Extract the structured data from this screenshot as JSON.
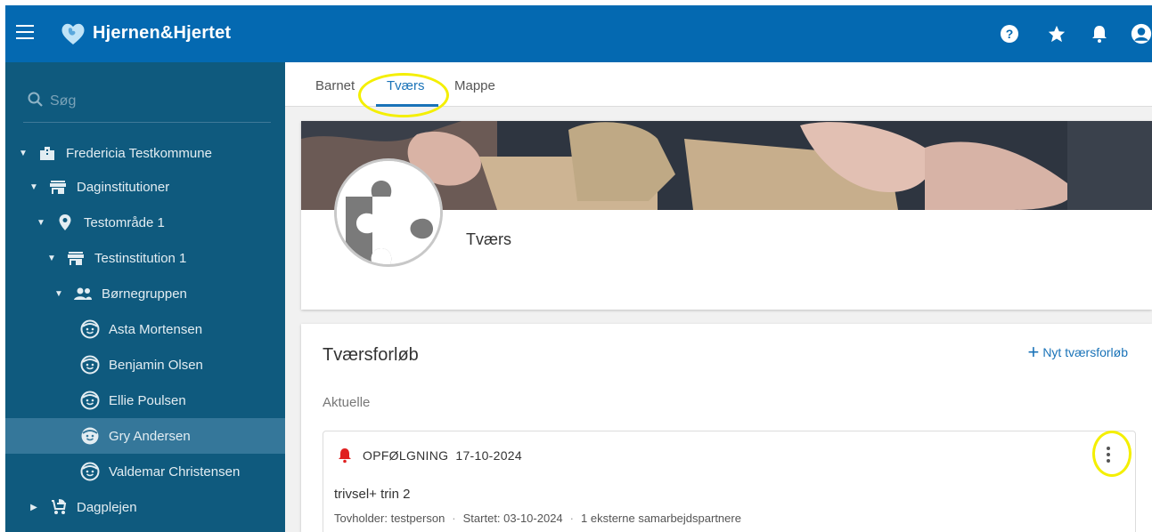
{
  "app": {
    "title": "Hjernen&Hjertet"
  },
  "topbar": {
    "icons": [
      "help-icon",
      "star-icon",
      "bell-icon",
      "account-icon"
    ]
  },
  "sidebar": {
    "search": {
      "placeholder": "Søg",
      "value": ""
    },
    "items": [
      {
        "label": "Fredericia Testkommune",
        "icon": "building-icon",
        "expanded": true
      },
      {
        "label": "Daginstitutioner",
        "icon": "store-icon",
        "expanded": true
      },
      {
        "label": "Testområde 1",
        "icon": "location-pin-icon",
        "expanded": true
      },
      {
        "label": "Testinstitution 1",
        "icon": "store-icon",
        "expanded": true
      },
      {
        "label": "Børnegruppen",
        "icon": "group-icon",
        "expanded": true
      },
      {
        "label": "Asta Mortensen",
        "icon": "child-face-icon"
      },
      {
        "label": "Benjamin Olsen",
        "icon": "child-face-icon"
      },
      {
        "label": "Ellie Poulsen",
        "icon": "child-face-icon"
      },
      {
        "label": "Gry Andersen",
        "icon": "child-face-icon",
        "selected": true
      },
      {
        "label": "Valdemar Christensen",
        "icon": "child-face-icon"
      },
      {
        "label": "Dagplejen",
        "icon": "stroller-icon",
        "expanded": false
      }
    ]
  },
  "tabs": [
    {
      "label": "Barnet"
    },
    {
      "label": "Tværs",
      "active": true
    },
    {
      "label": "Mappe"
    }
  ],
  "profile": {
    "name": "Tværs",
    "avatar_icon": "puzzle-icon"
  },
  "forlob": {
    "title": "Tværsforløb",
    "new_button": "Nyt tværsforløb",
    "section_label": "Aktuelle",
    "items": [
      {
        "status": "OPFØLGNING",
        "date": "17-10-2024",
        "name": "trivsel+ trin 2",
        "holder": "Tovholder: testperson",
        "started": "Startet: 03-10-2024",
        "partners": "1 eksterne samarbejdspartnere"
      }
    ]
  },
  "colors": {
    "topbar": "#0469b1",
    "sidebar": "#0f5a7e",
    "sidebar_selected": "#35779a",
    "accent": "#1a73b8",
    "alert": "#e02020",
    "annotation_highlight": "#f4ef00"
  }
}
